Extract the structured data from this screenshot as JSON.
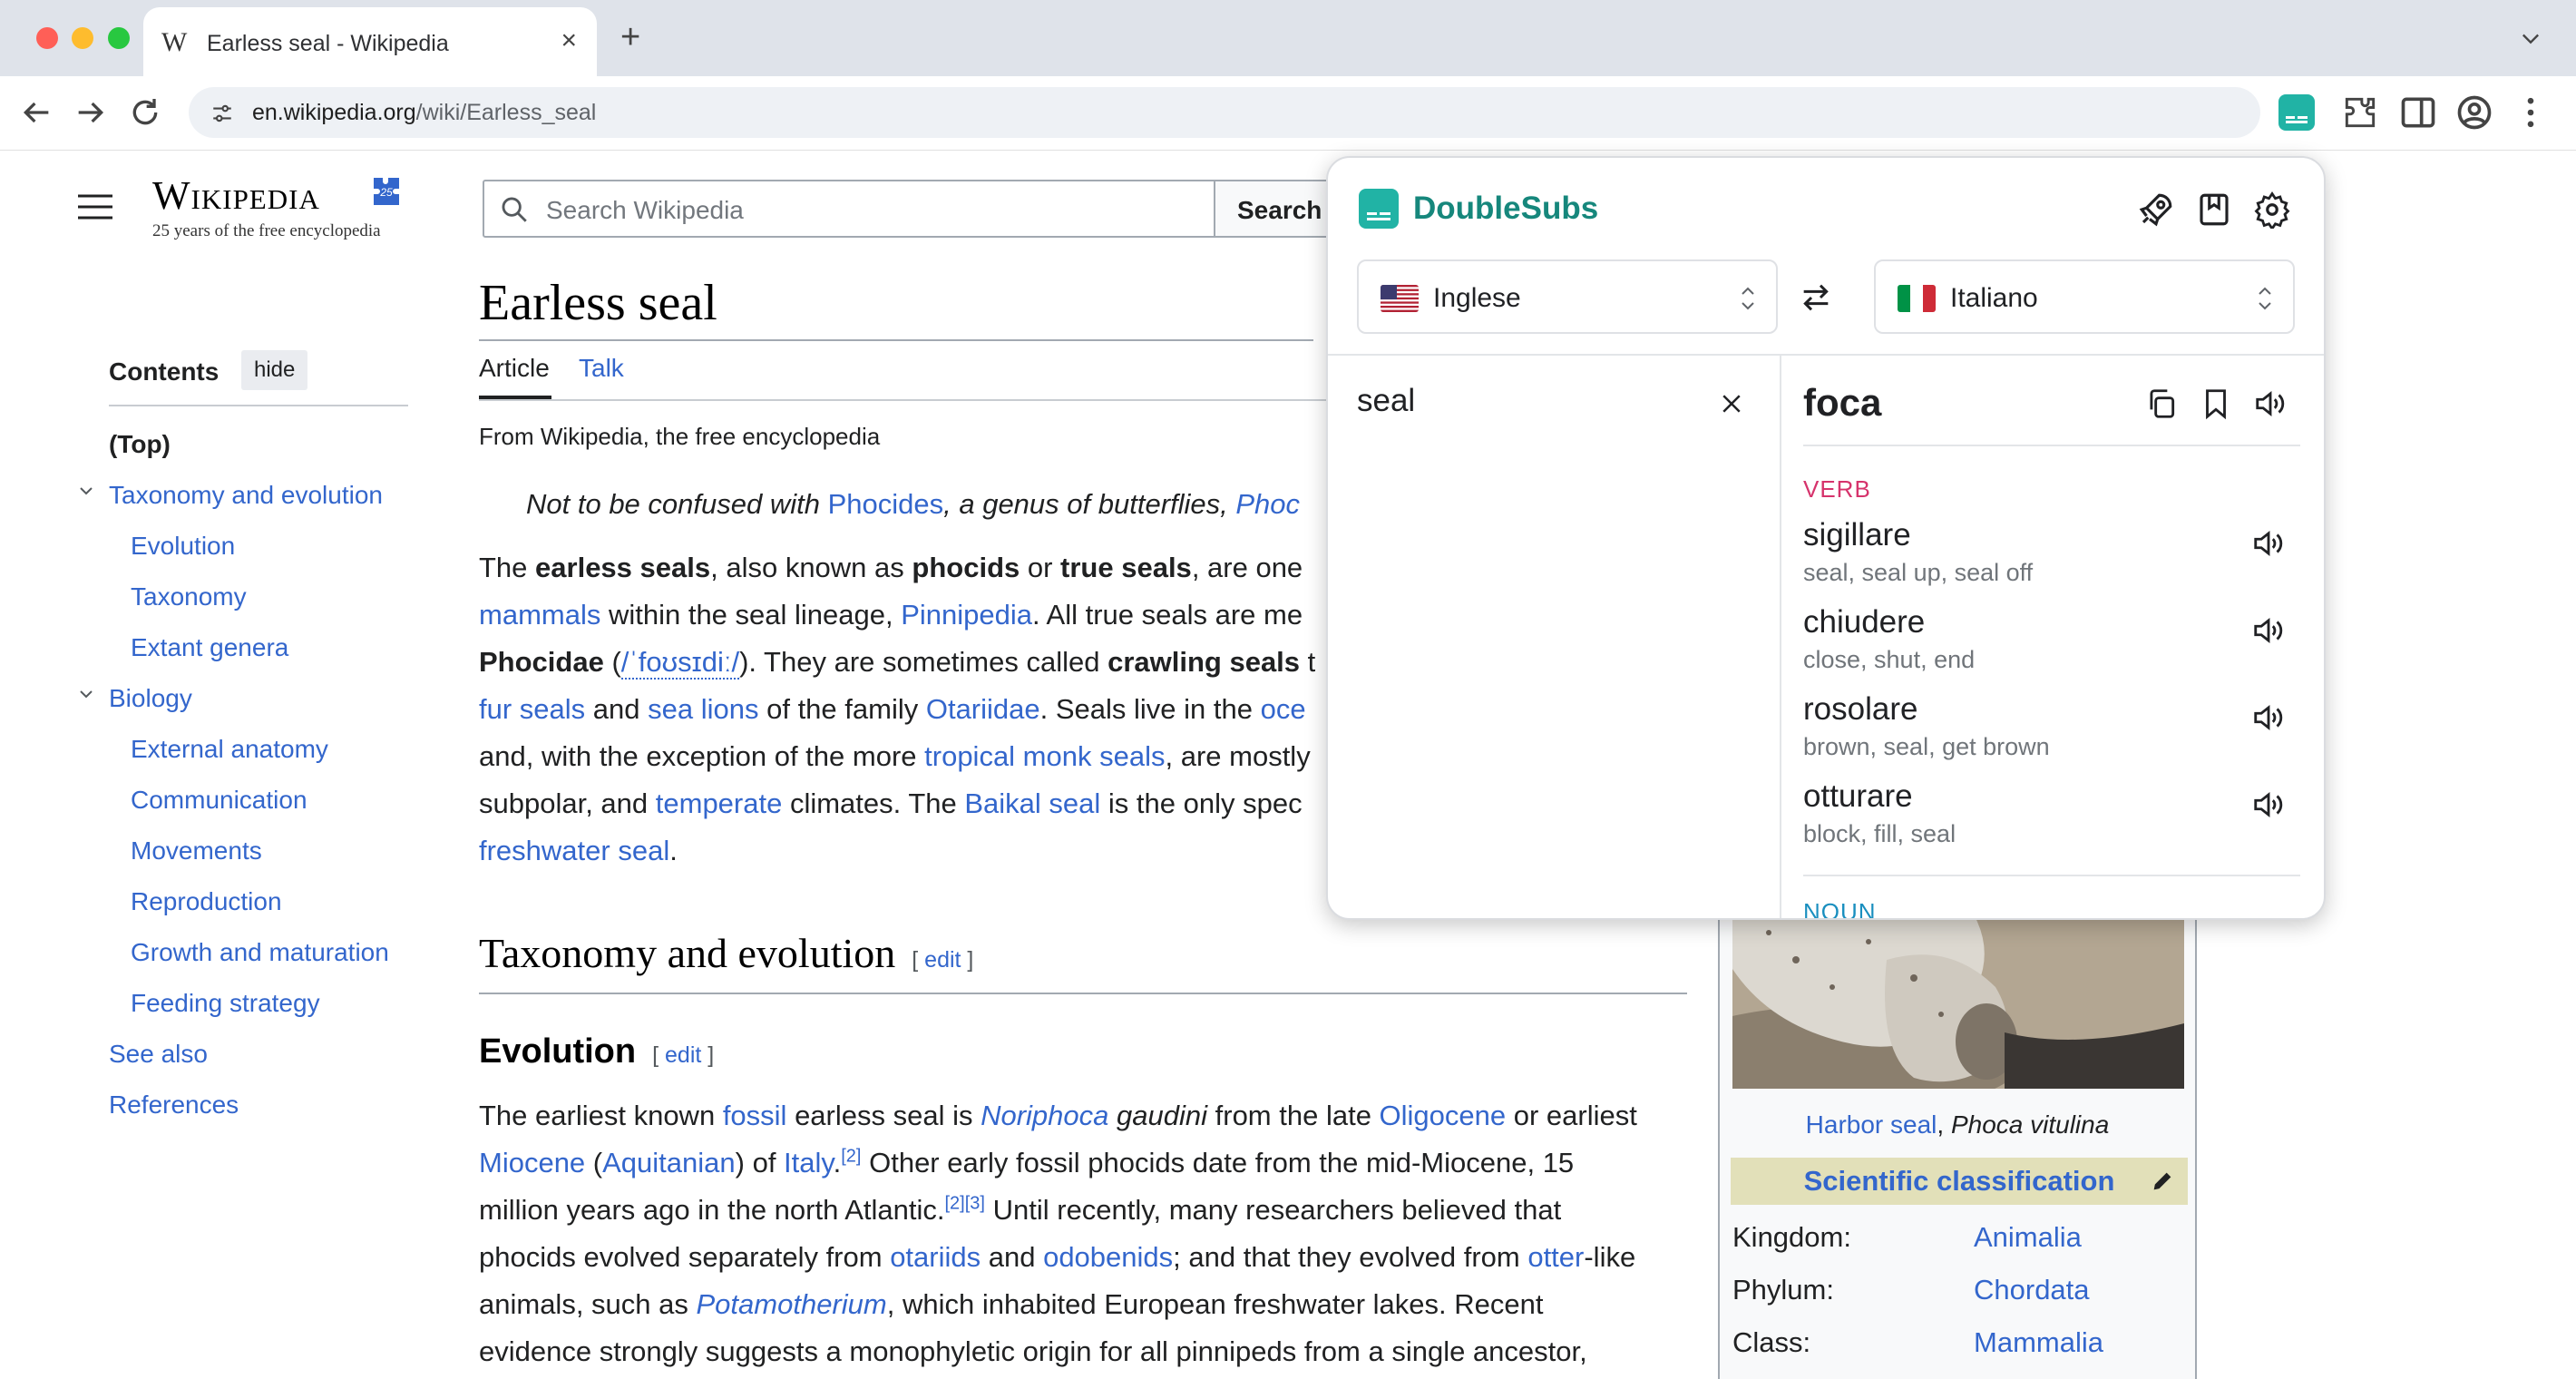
{
  "browser": {
    "tab_title": "Earless seal - Wikipedia",
    "tab_favicon": "W",
    "url_host": "en.wikipedia.org",
    "url_path": "/wiki/Earless_seal"
  },
  "wikipedia": {
    "logo_word": "Wikipedia",
    "logo_tagline": "25 years of the free encyclopedia",
    "search_placeholder": "Search Wikipedia",
    "search_button": "Search",
    "toc": {
      "heading": "Contents",
      "hide": "hide",
      "items": [
        "(Top)",
        "Taxonomy and evolution",
        "Evolution",
        "Taxonomy",
        "Extant genera",
        "Biology",
        "External anatomy",
        "Communication",
        "Movements",
        "Reproduction",
        "Growth and maturation",
        "Feeding strategy",
        "See also",
        "References"
      ]
    },
    "article": {
      "title": "Earless seal",
      "tabs": [
        "Article",
        "Talk"
      ],
      "from": "From Wikipedia, the free encyclopedia",
      "hatnote": {
        "pre": "Not to be confused with ",
        "link1": "Phocides",
        "mid": ", a genus of butterflies, ",
        "link2": "Phoc"
      },
      "intro": {
        "l1": {
          "a": "The ",
          "b1": "earless seals",
          "c": ", also known as ",
          "b2": "phocids",
          "d": " or ",
          "b3": "true seals",
          "e": ", are one"
        },
        "l2": {
          "a1": "mammals",
          "b": " within the seal lineage, ",
          "a2": "Pinnipedia",
          "c": ". All true seals are me"
        },
        "l3": {
          "b1": "Phocidae",
          "a": " (",
          "ipa": "/ˈfoʊsɪdiː/",
          "c": "). They are sometimes called ",
          "b2": "crawling seals",
          "d": " t"
        },
        "l4": {
          "a1": "fur seals",
          "b": " and ",
          "a2": "sea lions",
          "c": " of the family ",
          "a3": "Otariidae",
          "d": ". Seals live in the ",
          "a4": "oce"
        },
        "l5": {
          "a": "and, with the exception of the more ",
          "a1": "tropical monk seals",
          "b": ", are mostly"
        },
        "l6": {
          "a": "subpolar, and ",
          "a1": "temperate",
          "b": " climates. The ",
          "a2": "Baikal seal",
          "c": " is the only spec"
        },
        "l7": {
          "a1": "freshwater seal",
          "b": "."
        }
      },
      "h2_taxonomy": "Taxonomy and evolution",
      "h3_evolution": "Evolution",
      "edit": "edit",
      "evo": {
        "l1": {
          "a": "The earliest known ",
          "a1": "fossil",
          "b": " earless seal is ",
          "i1": "Noriphoca",
          "c": " ",
          "i2": "gaudini",
          "d": " from the late ",
          "a2": "Oligocene",
          "e": " or earliest"
        },
        "l2": {
          "a1": "Miocene",
          "b": " (",
          "a2": "Aquitanian",
          "c": ") of ",
          "a3": "Italy",
          "d": ".",
          "s1": "[2]",
          "e": " Other early fossil phocids date from the mid-Miocene, 15"
        },
        "l3": {
          "a": "million years ago in the north Atlantic.",
          "s1": "[2]",
          "s2": "[3]",
          "b": " Until recently, many researchers believed that"
        },
        "l4": {
          "a": "phocids evolved separately from ",
          "a1": "otariids",
          "b": " and ",
          "a2": "odobenids",
          "c": "; and that they evolved from ",
          "a3": "otter",
          "d": "-like"
        },
        "l5": {
          "a": "animals, such as ",
          "i1": "Potamotherium",
          "b": ", which inhabited European freshwater lakes. Recent"
        },
        "l6": {
          "a": "evidence strongly suggests a monophyletic origin for all pinnipeds from a single ancestor,"
        }
      }
    },
    "infobox": {
      "caption_link": "Harbor seal",
      "caption_sep": ", ",
      "caption_species": "Phoca vitulina",
      "sci_heading": "Scientific classification",
      "rows": [
        {
          "label": "Kingdom:",
          "value": "Animalia"
        },
        {
          "label": "Phylum:",
          "value": "Chordata"
        },
        {
          "label": "Class:",
          "value": "Mammalia"
        }
      ]
    }
  },
  "popup": {
    "name": "DoubleSubs",
    "source_lang": "Inglese",
    "target_lang": "Italiano",
    "source_text": "seal",
    "translation": "foca",
    "sections": [
      {
        "pos": "VERB",
        "entries": [
          {
            "word": "sigillare",
            "synonyms": "seal, seal up, seal off"
          },
          {
            "word": "chiudere",
            "synonyms": "close, shut, end"
          },
          {
            "word": "rosolare",
            "synonyms": "brown, seal, get brown"
          },
          {
            "word": "otturare",
            "synonyms": "block, fill, seal"
          }
        ]
      },
      {
        "pos": "NOUN",
        "entries": []
      }
    ],
    "accent_color": "#21b3a5"
  }
}
